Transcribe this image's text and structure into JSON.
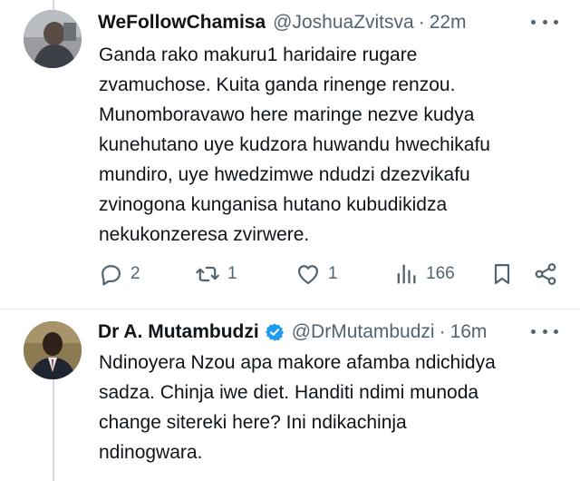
{
  "tweets": [
    {
      "display_name": "WeFollowChamisa",
      "handle": "@JoshuaZvitsva",
      "separator": "·",
      "time": "22m",
      "lines": [
        "Ganda rako makuru1 haridaire rugare",
        "zvamuchose. Kuita ganda rinenge renzou.",
        "Munomboravawo here maringe nezve kudya",
        "kunehutano uye kudzora huwandu  hwechikafu",
        "mundiro, uye hwedzimwe ndudzi dzezvikafu",
        "zvinogona kunganisa hutano kubudikidza",
        "nekukonzeresa zvirwere."
      ],
      "actions": {
        "replies": "2",
        "reposts": "1",
        "likes": "1",
        "views": "166"
      },
      "icons": [
        "reply-icon",
        "repost-icon",
        "like-icon",
        "views-icon",
        "bookmark-icon",
        "share-icon",
        "more-icon"
      ]
    },
    {
      "display_name": "Dr A. Mutambudzi",
      "handle": "@DrMutambudzi",
      "separator": "·",
      "time": "16m",
      "verified": true,
      "lines": [
        "Ndinoyera Nzou apa makore afamba ndichidya",
        "sadza. Chinja iwe diet. Handiti ndimi munoda",
        "change sitereki here? Ini ndikachinja",
        "ndinogwara."
      ]
    }
  ],
  "colors": {
    "text": "#0f1419",
    "secondary": "#536471",
    "verified": "#1d9bf0",
    "divider": "#e6ecf0",
    "thread_line": "#cfd9de"
  }
}
